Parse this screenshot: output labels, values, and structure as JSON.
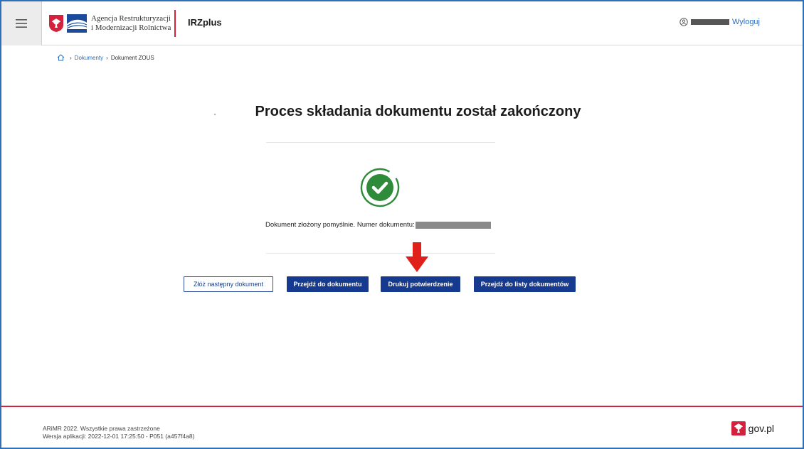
{
  "header": {
    "agency_line1": "Agencja Restrukturyzacji",
    "agency_line2": "i Modernizacji Rolnictwa",
    "app_name": "IRZplus",
    "logout_label": "Wyloguj"
  },
  "breadcrumb": {
    "items": [
      "Dokumenty",
      "Dokument ZOUS"
    ]
  },
  "main": {
    "title": "Proces składania dokumentu został zakończony",
    "message": "Dokument złożony pomyślnie. Numer dokumentu:",
    "buttons": {
      "next_document": "Złóż następny dokument",
      "go_to_document": "Przejdź do dokumentu",
      "print_confirmation": "Drukuj potwierdzenie",
      "go_to_list": "Przejdź do listy dokumentów"
    }
  },
  "footer": {
    "copyright": "ARiMR 2022. Wszystkie prawa zastrzeżone",
    "version": "Wersja aplikacji: 2022-12-01 17:25:50 - P051 (a457f4a8)",
    "gov_label": "gov.pl"
  },
  "colors": {
    "primary": "#163a8f",
    "link": "#2a6cc4",
    "accent_red": "#d4213d",
    "success_green": "#2e8b3a",
    "arrow_red": "#e0201a"
  },
  "icons": [
    "menu-icon",
    "eagle-icon",
    "arimr-logo",
    "user-icon",
    "home-icon",
    "check-circle-icon",
    "arrow-down-icon"
  ]
}
